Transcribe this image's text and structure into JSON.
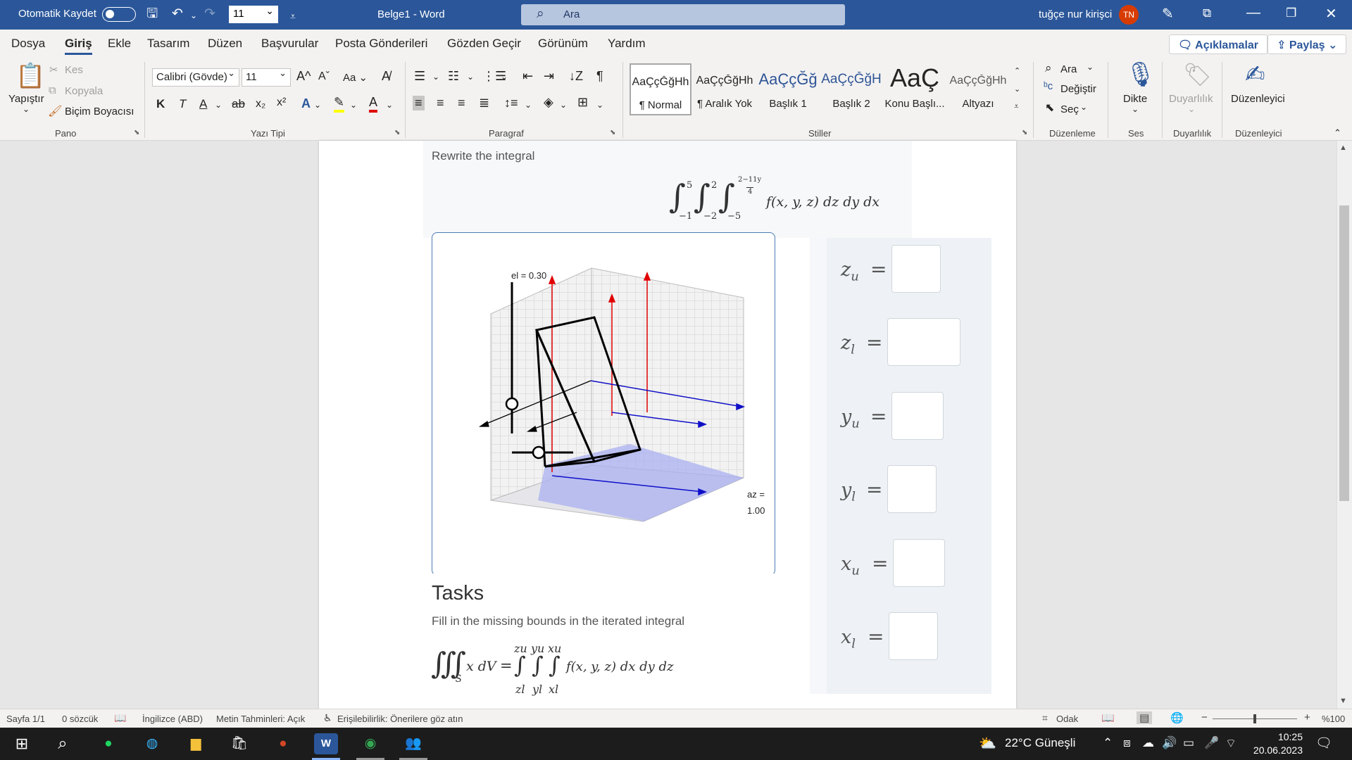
{
  "titlebar": {
    "autosave_label": "Otomatik Kaydet",
    "font_size_value": "11",
    "doc_title": "Belge1  -  Word",
    "search_placeholder": "Ara",
    "user_name": "tuğçe nur kirişci",
    "user_initials": "TN"
  },
  "menu": {
    "tabs": [
      "Dosya",
      "Giriş",
      "Ekle",
      "Tasarım",
      "Düzen",
      "Başvurular",
      "Posta Gönderileri",
      "Gözden Geçir",
      "Görünüm",
      "Yardım"
    ],
    "active_tab": "Giriş",
    "comments_label": "Açıklamalar",
    "share_label": "Paylaş"
  },
  "ribbon": {
    "clipboard": {
      "paste": "Yapıştır",
      "cut": "Kes",
      "copy": "Kopyala",
      "format_painter": "Biçim Boyacısı",
      "group": "Pano"
    },
    "font": {
      "family": "Calibri (Gövde)",
      "size": "11",
      "case_btn": "Aa",
      "group": "Yazı Tipi"
    },
    "paragraph": {
      "group": "Paragraf"
    },
    "styles": {
      "group": "Stiller",
      "items": [
        {
          "sample": "AaÇçĞğHh",
          "name": "¶ Normal"
        },
        {
          "sample": "AaÇçĞğHh",
          "name": "¶ Aralık Yok"
        },
        {
          "sample": "AaÇçĞğ",
          "name": "Başlık 1"
        },
        {
          "sample": "AaÇçĞğH",
          "name": "Başlık 2"
        },
        {
          "sample": "AaÇ",
          "name": "Konu Başlı..."
        },
        {
          "sample": "AaÇçĞğHh",
          "name": "Altyazı"
        }
      ]
    },
    "editing": {
      "find": "Ara",
      "replace": "Değiştir",
      "select": "Seç",
      "group": "Düzenleme"
    },
    "voice": {
      "dictate": "Dikte",
      "group": "Ses"
    },
    "sensitivity": {
      "label": "Duyarlılık",
      "group": "Duyarlılık"
    },
    "editor": {
      "label": "Düzenleyici",
      "group": "Düzenleyici"
    }
  },
  "document": {
    "intro": "Rewrite the integral",
    "integral": {
      "outer_upper": "5",
      "outer_lower": "−1",
      "mid_upper": "2",
      "mid_lower": "−2",
      "inner_upper_num": "2−11y",
      "inner_upper_den": "4",
      "inner_lower": "−5",
      "integrand": "f(x, y, z) dz dy dx"
    },
    "plot": {
      "el_label": "el = 0.30",
      "az_label": "az =",
      "az_value": "1.00"
    },
    "tasks_heading": "Tasks",
    "tasks_text": "Fill in the missing bounds in the iterated integral",
    "iterated": {
      "lhs_body": "x dV",
      "lhs_region": "S",
      "u1": "zu",
      "u2": "yu",
      "u3": "xu",
      "l1": "zl",
      "l2": "yl",
      "l3": "xl",
      "integrand": "f(x, y, z) dx dy dz"
    },
    "bounds": [
      {
        "var": "z",
        "sub": "u"
      },
      {
        "var": "z",
        "sub": "l"
      },
      {
        "var": "y",
        "sub": "u"
      },
      {
        "var": "y",
        "sub": "l"
      },
      {
        "var": "x",
        "sub": "u"
      },
      {
        "var": "x",
        "sub": "l"
      }
    ]
  },
  "status": {
    "page": "Sayfa 1/1",
    "words": "0 sözcük",
    "language": "İngilizce (ABD)",
    "predictions": "Metin Tahminleri: Açık",
    "accessibility": "Erişilebilirlik: Önerilere göz atın",
    "focus": "Odak",
    "zoom": "%100"
  },
  "taskbar": {
    "weather": "22°C  Güneşli",
    "time": "10:25",
    "date": "20.06.2023"
  }
}
